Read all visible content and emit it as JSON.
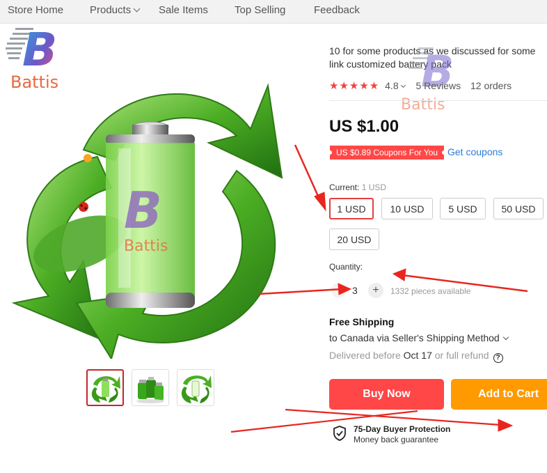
{
  "nav": {
    "items": [
      {
        "label": "Store Home"
      },
      {
        "label": "Products"
      },
      {
        "label": "Sale Items"
      },
      {
        "label": "Top Selling"
      },
      {
        "label": "Feedback"
      }
    ]
  },
  "brand": {
    "name": "Battis",
    "watermark_name": "Battis",
    "image_watermark_name": "Battis"
  },
  "product": {
    "title": "10 for some products as we discussed for some link customized battery pack",
    "rating": "4.8",
    "reviews": "5 Reviews",
    "orders": "12 orders",
    "price": "US $1.00",
    "coupon": "US $0.89 Coupons For You",
    "get_coupons": "Get coupons",
    "image_icons": [
      "recycle-arrows-icon",
      "battery-icon",
      "ladybug-icon"
    ]
  },
  "options": {
    "current_label": "Current:",
    "current_value": "1 USD",
    "items": [
      "1 USD",
      "10 USD",
      "5 USD",
      "50 USD",
      "20 USD"
    ],
    "selected": "1 USD"
  },
  "quantity": {
    "label": "Quantity:",
    "value": "3",
    "plus": "+",
    "available": "1332 pieces available"
  },
  "shipping": {
    "title": "Free Shipping",
    "to": "to Canada via Seller's Shipping Method",
    "delivered_prefix": "Delivered before",
    "date": "Oct 17",
    "suffix": "or full refund",
    "help": "?"
  },
  "actions": {
    "buy_now": "Buy Now",
    "add_to_cart": "Add to Cart"
  },
  "protection": {
    "title": "75-Day Buyer Protection",
    "subtitle": "Money back guarantee"
  },
  "colors": {
    "accent_red": "#ff4747",
    "cart_orange": "#ff9a00",
    "link_blue": "#2e7ad8",
    "green": "#3aa51e"
  }
}
